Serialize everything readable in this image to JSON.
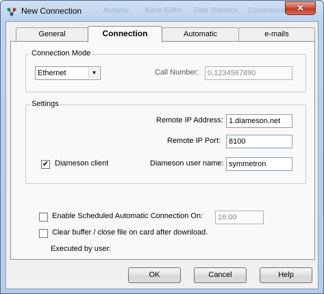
{
  "window": {
    "title": "New Connection",
    "close_glyph": "✕",
    "ghost_titles": [
      "Analysis",
      "Alarm Editor",
      "Data Statistics",
      "Connections"
    ]
  },
  "tabs": [
    {
      "label": "General",
      "active": false
    },
    {
      "label": "Connection",
      "active": true
    },
    {
      "label": "Automatic",
      "active": false
    },
    {
      "label": "e-mails",
      "active": false
    }
  ],
  "connection_mode": {
    "group_label": "Connection Mode",
    "mode_value": "Ethernet",
    "call_number_label": "Call Number:",
    "call_number_value": "0,1234567890"
  },
  "settings": {
    "group_label": "Settings",
    "remote_ip_address_label": "Remote IP Address:",
    "remote_ip_address_value": "1.diameson.net",
    "remote_ip_port_label": "Remote IP Port:",
    "remote_ip_port_value": "8100",
    "diameson_client_label": "Diameson client",
    "diameson_client_checked": "✔",
    "diameson_user_label": "Diameson user name:",
    "diameson_user_value": "symmetron"
  },
  "options": {
    "scheduled_label": "Enable Scheduled Automatic Connection On:",
    "scheduled_time": "16:00",
    "clear_buffer_label": "Clear buffer / close file on card after download.",
    "executed_by_label": "Executed by user:"
  },
  "buttons": {
    "ok": "OK",
    "cancel": "Cancel",
    "help": "Help"
  },
  "icons": {
    "app": "network-connection-icon",
    "checkbox": "checkmark-icon",
    "dropdown": "dropdown-arrow-icon"
  },
  "colors": {
    "close": "#c0392b",
    "field_border": "#7f9db9",
    "titlebar": "#bcd3ee"
  }
}
